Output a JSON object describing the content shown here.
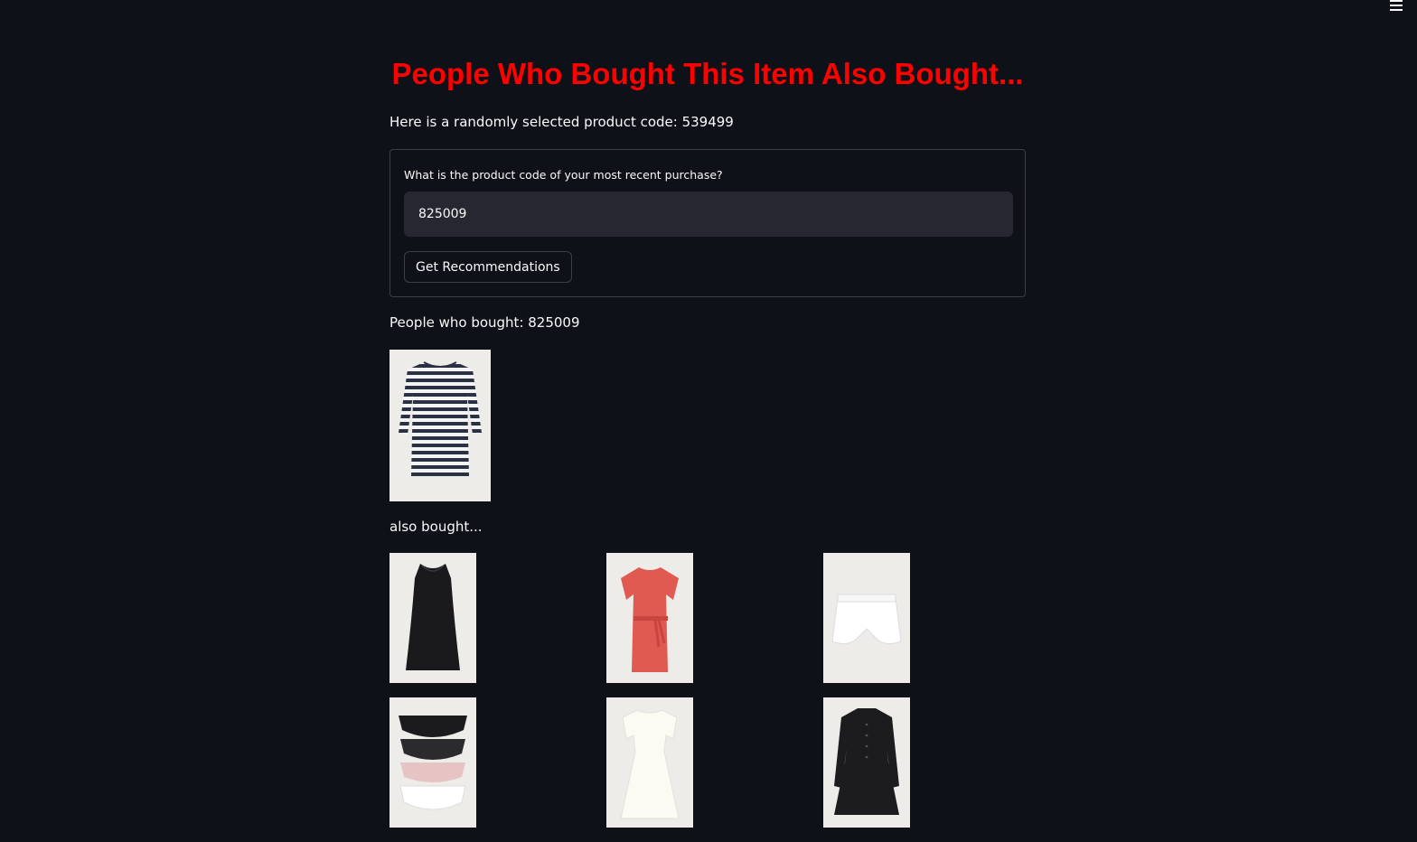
{
  "header": {
    "menu_icon": "hamburger-menu-icon"
  },
  "page": {
    "title": "People Who Bought This Item Also Bought...",
    "random_prefix": "Here is a randomly selected product code: 539499"
  },
  "form": {
    "label": "What is the product code of your most recent purchase?",
    "input_value": "825009",
    "button_label": "Get Recommendations"
  },
  "results": {
    "bought_text": "People who bought: 825009",
    "also_text": "also bought..."
  },
  "images": {
    "main_product": "striped-dress-image",
    "recommendations": [
      "black-sleeveless-dress-image",
      "red-belted-dress-image",
      "white-shorts-image",
      "lace-briefs-pack-image",
      "white-dress-image",
      "black-button-dress-image"
    ]
  },
  "colors": {
    "background": "#0e1117",
    "title": "#ff0000",
    "input_background": "#262730",
    "text": "#fafafa"
  }
}
